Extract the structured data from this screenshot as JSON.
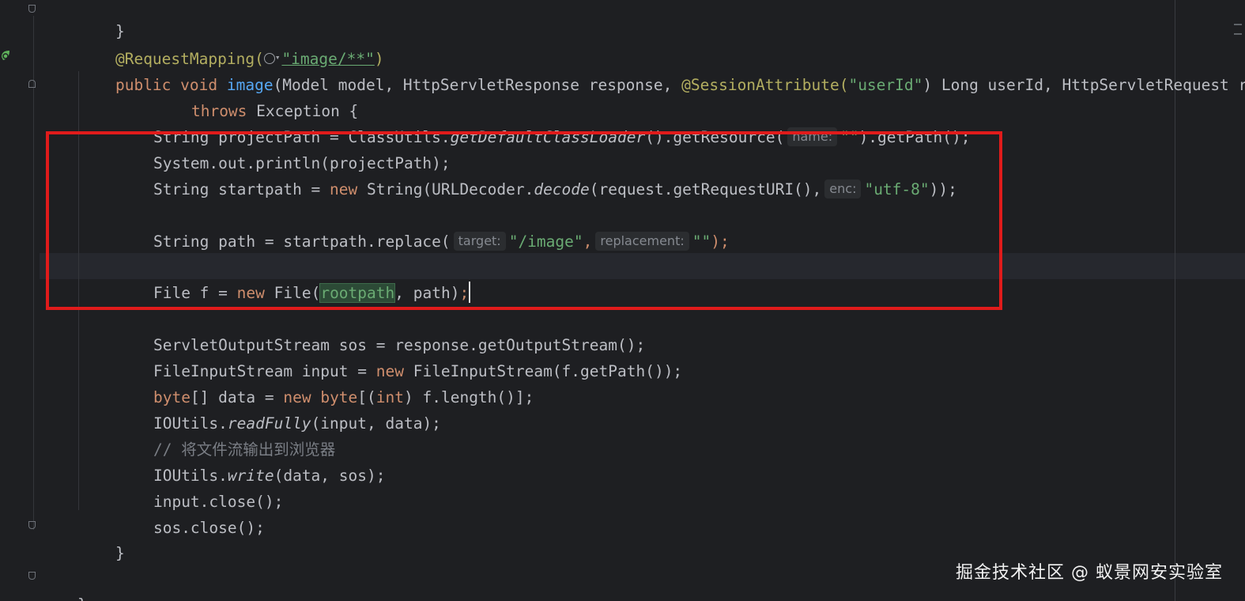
{
  "code": {
    "closing_brace_prev": "}",
    "annotation_request_mapping": "@RequestMapping(",
    "annotation_path": "\"image/**\"",
    "annotation_close": ")",
    "method_sig_kw": "public void ",
    "method_name": "image",
    "method_params_a": "(Model model, HttpServletResponse response, ",
    "method_session_attr": "@SessionAttribute(",
    "method_session_key": "\"userId\"",
    "method_params_b": ") Long userId, HttpServletRequest re",
    "throws_kw": "throws",
    "throws_rest": " Exception {",
    "l_project_a": "String projectPath = ClassUtils.",
    "l_project_fn": "getDefaultClassLoader",
    "l_project_b": "().getResource(",
    "hint_name": "name:",
    "l_project_str": "\"\"",
    "l_project_c": ").getPath();",
    "l_sysout": "System.out.println(projectPath);",
    "l_start_a": "String startpath = ",
    "kw_new": "new",
    "l_start_b": " String(URLDecoder.",
    "l_start_fn": "decode",
    "l_start_c": "(request.getRequestURI(),",
    "hint_enc": "enc:",
    "l_start_str": "\"utf-8\"",
    "l_start_d": "));",
    "l_path_a": "String path = startpath.replace(",
    "hint_target": "target:",
    "l_path_str1": "\"/image\"",
    "l_path_comma": ",",
    "hint_replacement": "replacement:",
    "l_path_str2": "\"\"",
    "l_path_end": ");",
    "l_file_a": "File f = ",
    "l_file_b": " File(",
    "l_file_root": "rootpath",
    "l_file_c": ", path)",
    "l_file_semi": ";",
    "l_sos": "ServletOutputStream sos = response.getOutputStream();",
    "l_fis_a": "FileInputStream input = ",
    "l_fis_b": " FileInputStream(f.getPath());",
    "kw_byte": "byte",
    "l_byte_a": "[] data = ",
    "l_byte_b": "[(",
    "kw_int": "int",
    "l_byte_c": ") f.length()];",
    "l_read_a": "IOUtils.",
    "l_read_fn": "readFully",
    "l_read_b": "(input, data);",
    "l_comment": "// 将文件流输出到浏览器",
    "l_write_a": "IOUtils.",
    "l_write_fn": "write",
    "l_write_b": "(data, sos);",
    "l_input_close": "input.close();",
    "l_sos_close": "sos.close();",
    "l_close_method": "}",
    "l_close_class": "}"
  },
  "watermark": "掘金技术社区 @ 蚁景网安实验室",
  "colors": {
    "background": "#1e1f22",
    "keyword": "#cf8e6d",
    "string": "#6aab73",
    "annotation": "#b3ae60",
    "highlight_box": "#e01b1b"
  }
}
